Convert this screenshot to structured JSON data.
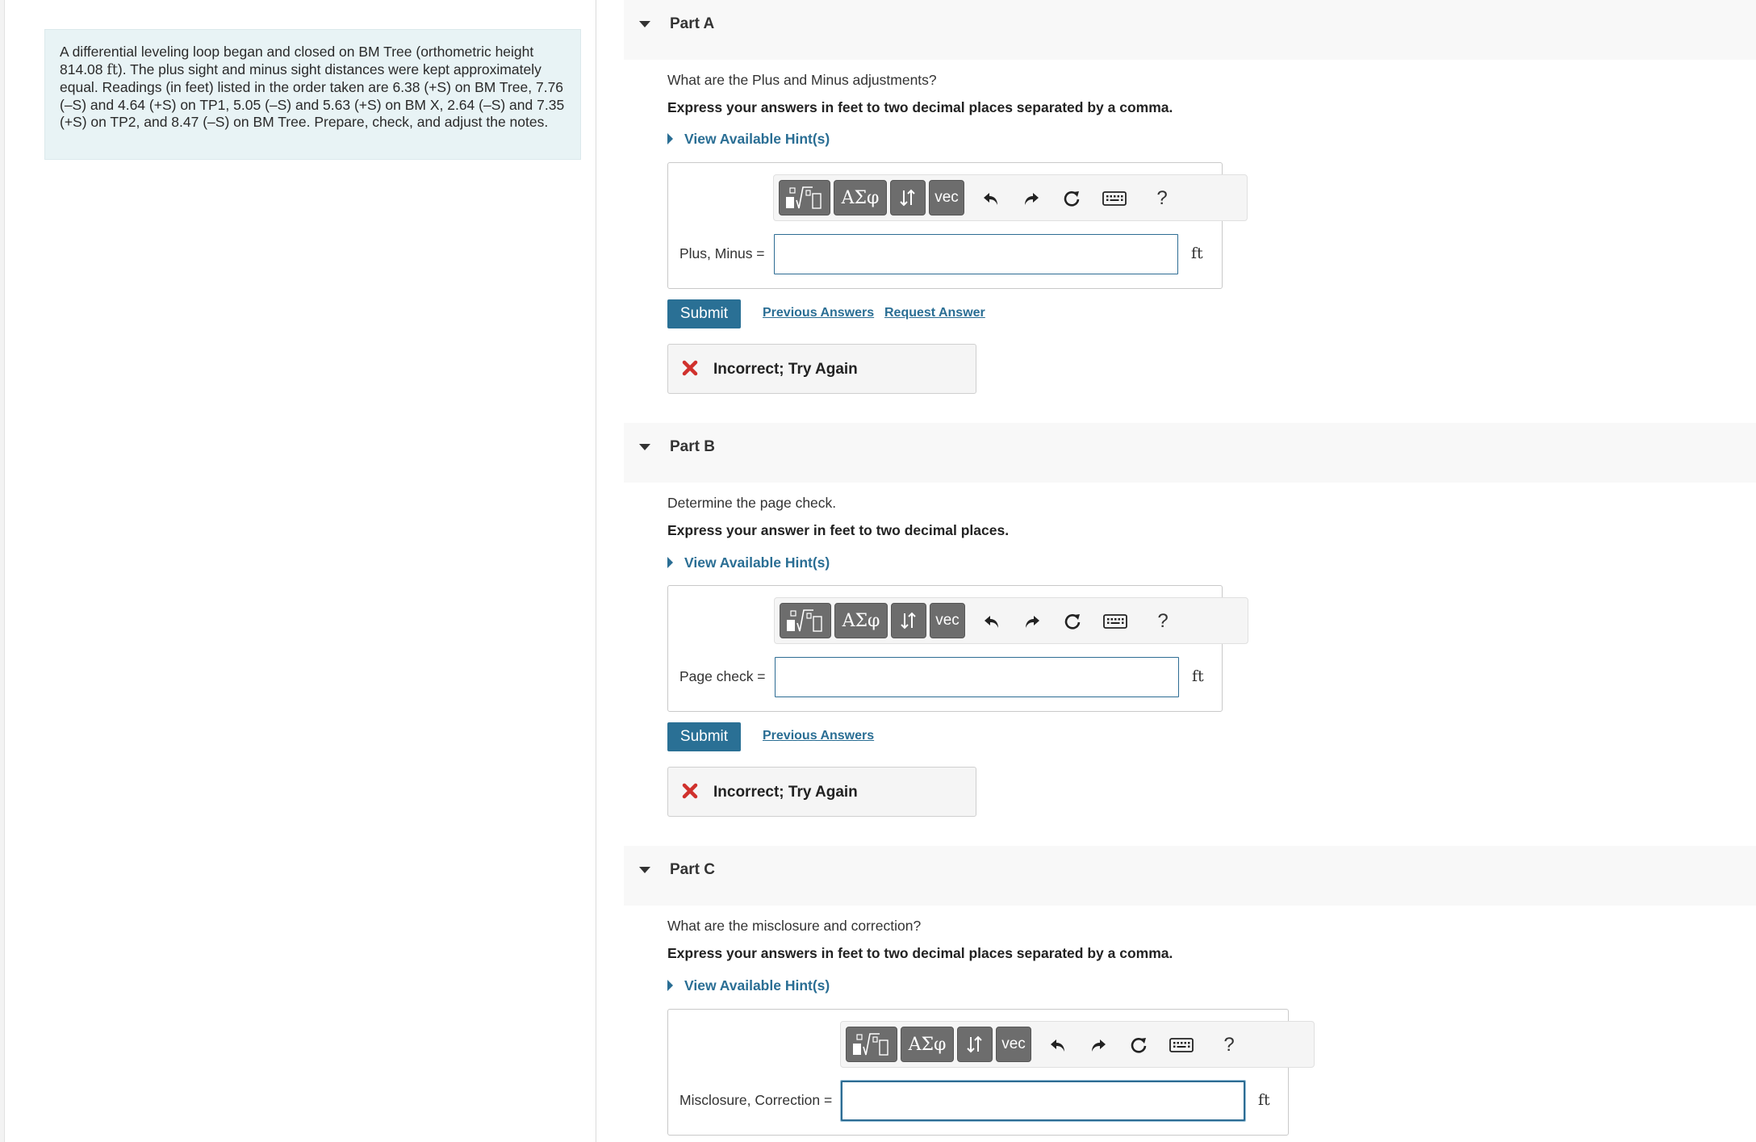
{
  "problem": {
    "text_part1": "A differential leveling loop began and closed on BM Tree (orthometric height 814.08 ",
    "unit": "ft",
    "text_part2": "). The plus sight and minus sight distances were kept approximately equal. Readings (in feet) listed in the order taken are 6.38 (+S) on BM Tree, 7.76 (–S) and 4.64 (+S) on TP1, 5.05 (–S) and 5.63 (+S) on BM X, 2.64 (–S) and 7.35 (+S) on TP2, and 8.47 (–S) on BM Tree. Prepare, check, and adjust the notes."
  },
  "toolbar": {
    "greek_label": "ΑΣφ",
    "vec_label": "vec",
    "help_label": "?"
  },
  "parts": {
    "a": {
      "title": "Part A",
      "question": "What are the Plus and Minus adjustments?",
      "instruction": "Express your answers in feet to two decimal places separated by a comma.",
      "hint_label": "View Available Hint(s)",
      "field_label": "Plus, Minus =",
      "field_value": "",
      "unit": "ft",
      "submit_label": "Submit",
      "previous_answers_label": "Previous Answers",
      "request_answer_label": "Request Answer",
      "feedback": "Incorrect; Try Again"
    },
    "b": {
      "title": "Part B",
      "question": "Determine the page check.",
      "instruction": "Express your answer in feet to two decimal places.",
      "hint_label": "View Available Hint(s)",
      "field_label": "Page check =",
      "field_value": "",
      "unit": "ft",
      "submit_label": "Submit",
      "previous_answers_label": "Previous Answers",
      "feedback": "Incorrect; Try Again"
    },
    "c": {
      "title": "Part C",
      "question": "What are the misclosure and correction?",
      "instruction": "Express your answers in feet to two decimal places separated by a comma.",
      "hint_label": "View Available Hint(s)",
      "field_label": "Misclosure, Correction =",
      "field_value": "",
      "unit": "ft"
    }
  },
  "colors": {
    "accent": "#2a7095",
    "link": "#2a6e94",
    "problem_bg": "#e8f3f5",
    "error": "#d0312d"
  }
}
